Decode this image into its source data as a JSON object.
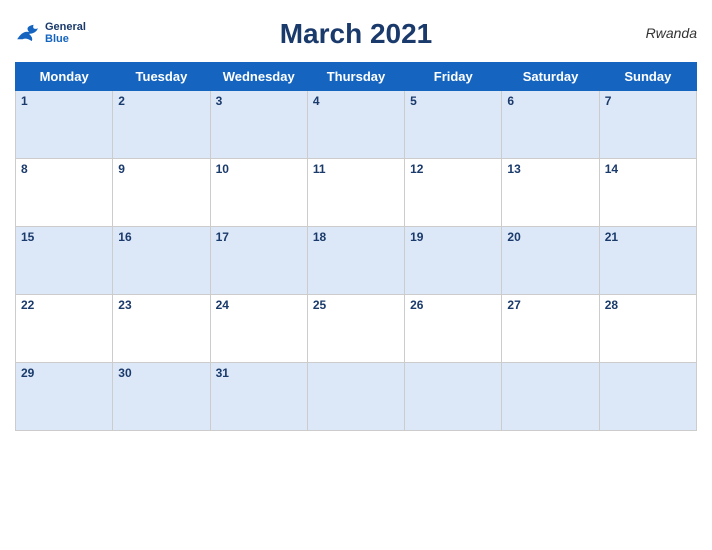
{
  "header": {
    "title": "March 2021",
    "country": "Rwanda",
    "logo": {
      "general": "General",
      "blue": "Blue"
    }
  },
  "weekdays": [
    "Monday",
    "Tuesday",
    "Wednesday",
    "Thursday",
    "Friday",
    "Saturday",
    "Sunday"
  ],
  "weeks": [
    [
      1,
      2,
      3,
      4,
      5,
      6,
      7
    ],
    [
      8,
      9,
      10,
      11,
      12,
      13,
      14
    ],
    [
      15,
      16,
      17,
      18,
      19,
      20,
      21
    ],
    [
      22,
      23,
      24,
      25,
      26,
      27,
      28
    ],
    [
      29,
      30,
      31,
      null,
      null,
      null,
      null
    ]
  ],
  "colors": {
    "header_bg": "#1565c0",
    "shaded_row": "#dce8f8",
    "text_dark": "#1a3a6b"
  }
}
